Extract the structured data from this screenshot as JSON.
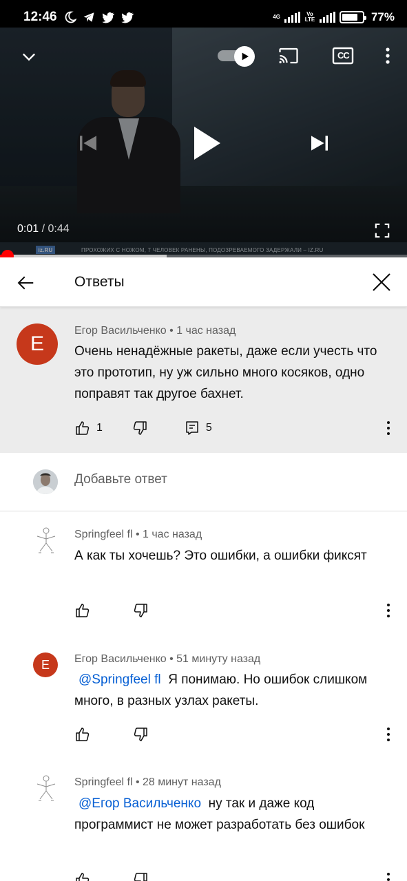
{
  "status_bar": {
    "time": "12:46",
    "network_label": "4G",
    "volte_label": "Vo LTE",
    "battery": "77%"
  },
  "video": {
    "current_time": "0:01",
    "separator": " / ",
    "duration": "0:44",
    "channel_logo": "iz.RU",
    "ticker_text": "ПРОХОЖИХ С НОЖОМ, 7 ЧЕЛОВЕК РАНЕНЫ, ПОДОЗРЕВАЕМОГО ЗАДЕРЖАЛИ – IZ.RU",
    "cc_label": "CC",
    "progress_played": 0.015,
    "progress_buffered": 0.41
  },
  "replies_header": {
    "title": "Ответы"
  },
  "parent_comment": {
    "avatar_letter": "Е",
    "author": "Егор Васильченко",
    "time": "1 час назад",
    "text": "Очень ненадёжные ракеты, даже если учесть что это прототип, ну уж сильно много косяков, одно поправят так другое бахнет.",
    "likes": "1",
    "replies": "5"
  },
  "add_reply": {
    "placeholder": "Добавьте ответ"
  },
  "replies": [
    {
      "author": "Springfeel fl",
      "time": "1 час назад",
      "mention": "",
      "text": "А как ты хочешь? Это ошибки, а ошибки фиксят"
    },
    {
      "avatar_letter": "Е",
      "author": "Егор Васильченко",
      "time": "51 минуту назад",
      "mention": "@Springfeel fl",
      "text": "Я понимаю. Но ошибок слишком много, в разных узлах ракеты."
    },
    {
      "author": "Springfeel fl",
      "time": "28 минут назад",
      "mention": "@Егор Васильченко",
      "text": "ну так и даже код программист не может разработать без ошибок"
    }
  ],
  "meta_separator": " • ",
  "colors": {
    "accent_red": "#ff0000",
    "avatar_red": "#c6381b",
    "mention_blue": "#065fd4",
    "parent_bg": "#ececec"
  }
}
